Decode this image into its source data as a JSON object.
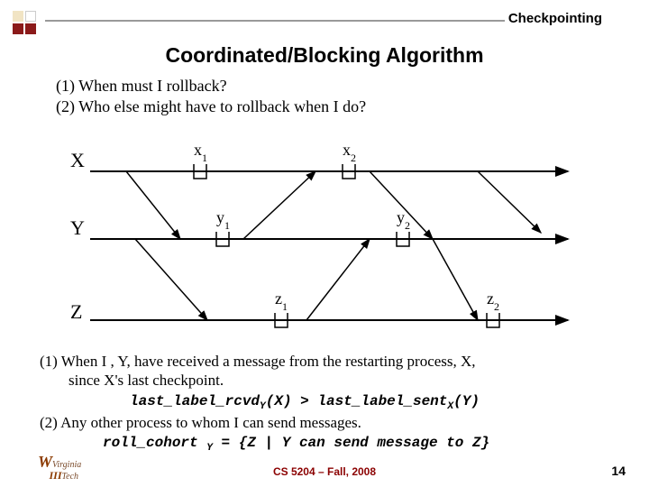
{
  "header": {
    "label": "Checkpointing"
  },
  "title": "Coordinated/Blocking Algorithm",
  "questions": {
    "q1": "(1) When must I rollback?",
    "q2": "(2) Who else might have to rollback when I do?"
  },
  "diagram": {
    "processes": [
      "X",
      "Y",
      "Z"
    ],
    "checkpoints": {
      "x1": "x",
      "x1sub": "1",
      "x2": "x",
      "x2sub": "2",
      "y1": "y",
      "y1sub": "1",
      "y2": "y",
      "y2sub": "2",
      "z1": "z",
      "z1sub": "1",
      "z2": "z",
      "z2sub": "2"
    }
  },
  "answers": {
    "a1_line1": "(1) When I , Y, have received a message from the restarting process, X,",
    "a1_line2": "since X's last checkpoint.",
    "a1_code_lhs": "last_label_rcvd",
    "a1_code_lhs_sub": "Y",
    "a1_code_lhs_arg": "(X) > ",
    "a1_code_rhs": "last_label_sent",
    "a1_code_rhs_sub": "X",
    "a1_code_rhs_arg": "(Y)",
    "a2_line1": "(2) Any other process to whom I can send messages.",
    "a2_code_lhs": "roll_cohort ",
    "a2_code_sub": "Y",
    "a2_code_rhs": " = {Z | Y can send message to Z}"
  },
  "footer": {
    "course": "CS 5204 – Fall, 2008",
    "page": "14",
    "vt_name": "Virginia",
    "vt_tech": "Tech"
  }
}
